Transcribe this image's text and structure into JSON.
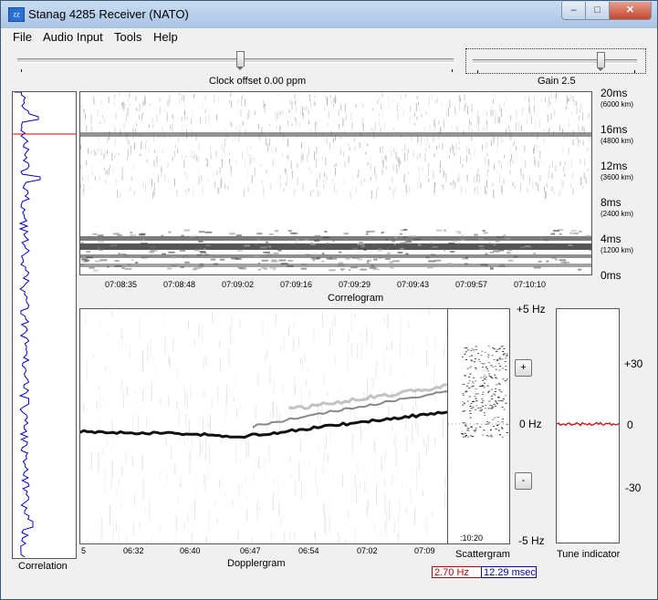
{
  "window": {
    "title": "Stanag 4285 Receiver (NATO)",
    "icon": "app-logo-icon",
    "min_glyph": "–",
    "max_glyph": "□",
    "close_glyph": "✕"
  },
  "menu": {
    "items": [
      "File",
      "Audio Input",
      "Tools",
      "Help"
    ]
  },
  "clock_offset": {
    "label": "Clock offset 0.00 ppm",
    "position": 0.51
  },
  "gain": {
    "label": "Gain 2.5",
    "position": 0.78
  },
  "correlation": {
    "label": "Correlation"
  },
  "correlogram": {
    "label": "Correlogram",
    "y_labels": [
      {
        "ms": "20ms",
        "km": "(6000 km)"
      },
      {
        "ms": "16ms",
        "km": "(4800 km)"
      },
      {
        "ms": "12ms",
        "km": "(3600 km)"
      },
      {
        "ms": "8ms",
        "km": "(2400 km)"
      },
      {
        "ms": "4ms",
        "km": "(1200 km)"
      },
      {
        "ms": "0ms",
        "km": ""
      }
    ],
    "x_labels": [
      "07:08:35",
      "07:08:48",
      "07:09:02",
      "07:09:16",
      "07:09:29",
      "07:09:43",
      "07:09:57",
      "07:10:10"
    ]
  },
  "dopplergram": {
    "label": "Dopplergram",
    "x_labels": [
      "5",
      "06:32",
      "06:40",
      "06:47",
      "06:54",
      "07:02",
      "07:09"
    ],
    "y_labels": [
      "+5 Hz",
      "0 Hz",
      "-5 Hz"
    ]
  },
  "scattergram": {
    "label": "Scattergram",
    "time": ":10:20",
    "plus": "+",
    "minus": "-"
  },
  "tune_indicator": {
    "label": "Tune indicator",
    "y_labels": [
      "+30",
      "0",
      "-30"
    ]
  },
  "readouts": {
    "freq": "2.70 Hz",
    "delay": "12.29 msec",
    "freq_color": "#c00000",
    "delay_color": "#0000b0"
  },
  "colors": {
    "accent_red": "#e00000",
    "trace_blue": "#0000cc"
  }
}
